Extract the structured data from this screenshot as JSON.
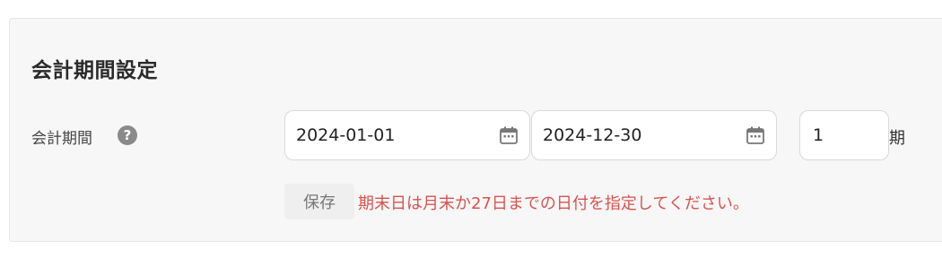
{
  "section": {
    "title": "会計期間設定"
  },
  "fiscal_period": {
    "label": "会計期間",
    "help_icon": "question-circle-icon",
    "start_date": "2024-01-01",
    "end_date": "2024-12-30",
    "calendar_icon": "calendar-icon",
    "period_count": "1",
    "period_unit": "期"
  },
  "actions": {
    "save_label": "保存"
  },
  "validation": {
    "error_message": "期末日は月末か27日までの日付を指定してください。",
    "error_color": "#d9534f"
  }
}
